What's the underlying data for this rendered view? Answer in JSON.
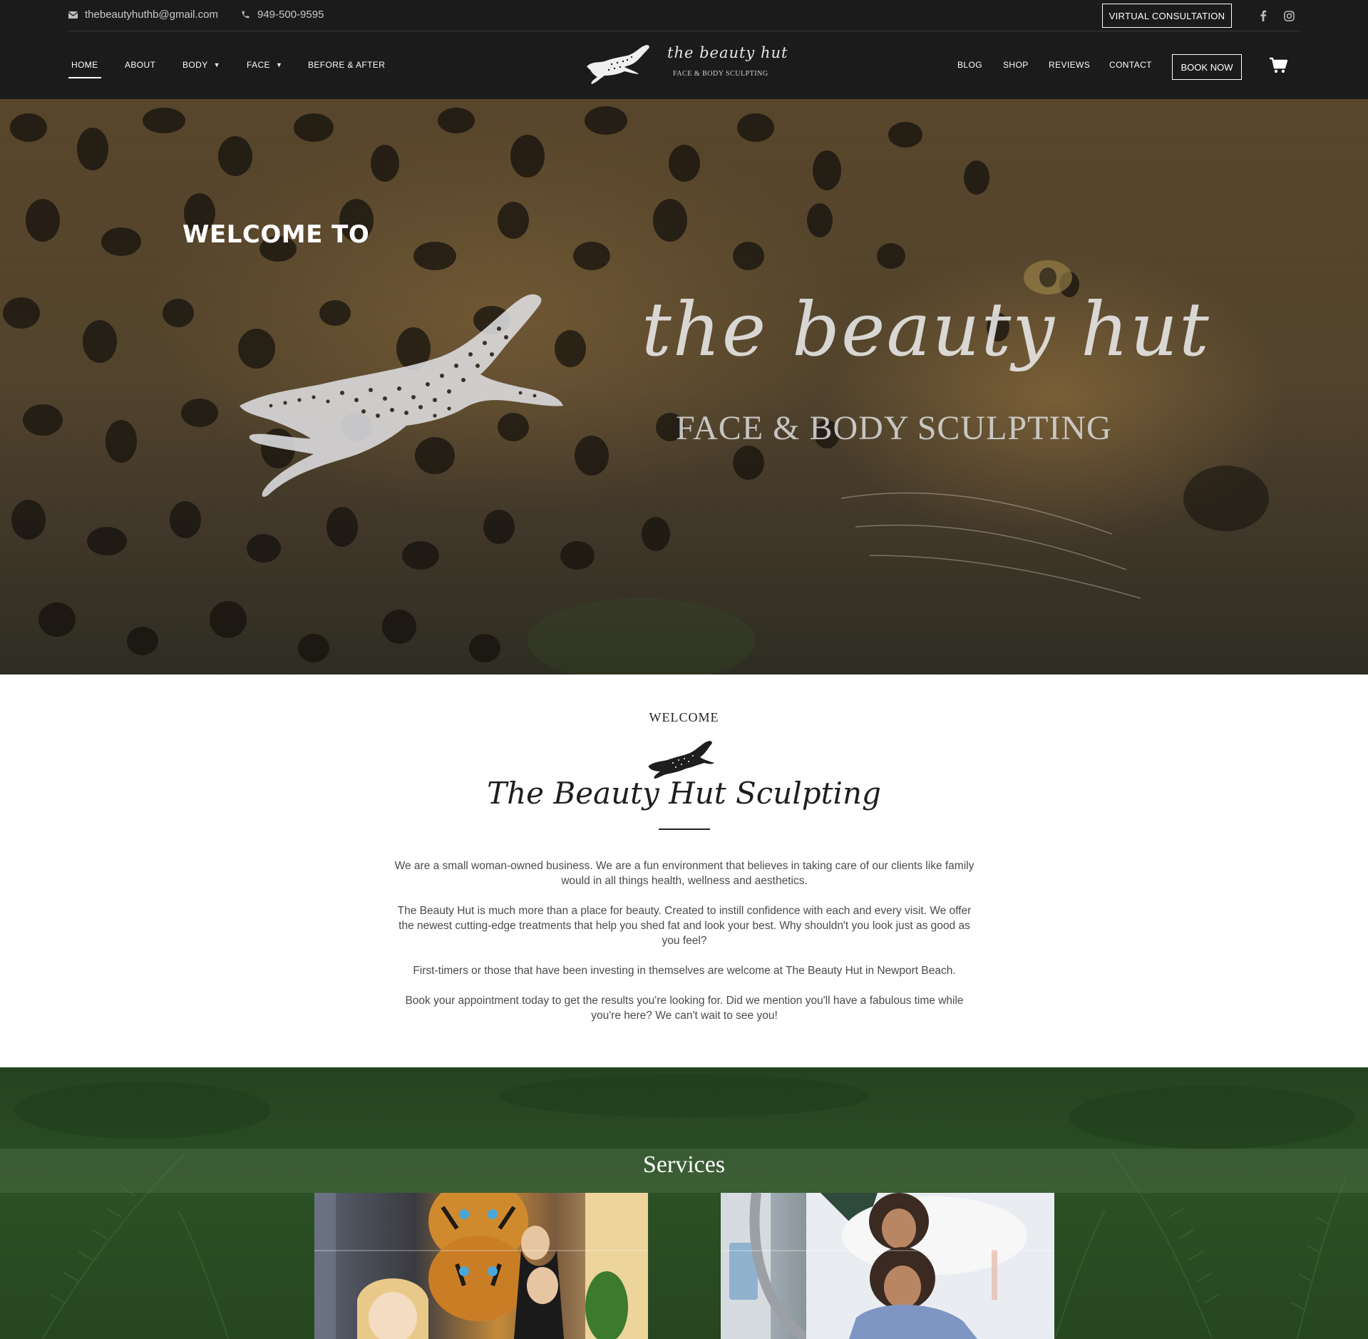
{
  "topbar": {
    "email": "thebeautyhuthb@gmail.com",
    "phone": "949-500-9595",
    "virtual_consultation": "VIRTUAL CONSULTATION",
    "social": [
      "facebook-icon",
      "instagram-icon"
    ]
  },
  "nav": {
    "left": [
      {
        "label": "HOME",
        "active": true
      },
      {
        "label": "ABOUT"
      },
      {
        "label": "BODY",
        "dropdown": true
      },
      {
        "label": "FACE",
        "dropdown": true
      },
      {
        "label": "BEFORE & AFTER"
      }
    ],
    "right": [
      {
        "label": "BLOG"
      },
      {
        "label": "SHOP"
      },
      {
        "label": "REVIEWS"
      },
      {
        "label": "CONTACT"
      }
    ],
    "book_now": "BOOK NOW",
    "logo_script": "the beauty hut",
    "logo_sub": "FACE & BODY SCULPTING"
  },
  "hero": {
    "welcome": "WELCOME TO",
    "brand": "the beauty hut",
    "tagline": "FACE & BODY SCULPTING"
  },
  "welcome": {
    "eyebrow": "WELCOME",
    "title": "The Beauty Hut Sculpting",
    "paragraphs": [
      "We are a small woman-owned business. We are a fun environment that believes in taking care of our clients like family would in all things health, wellness and aesthetics.",
      "The Beauty Hut is much more than a place for beauty. Created to instill confidence with each and every visit. We offer the newest cutting-edge treatments that help you shed fat and look your best. Why shouldn't you look just as good as you feel?",
      "First-timers or those that have been investing in themselves are welcome at The Beauty Hut in Newport Beach.",
      "Book your appointment today to get the results you're looking for. Did we mention you'll have a fabulous time while you're here? We can't wait to see you!"
    ]
  },
  "services": {
    "title": "Services"
  },
  "colors": {
    "header_bg": "#1b1b1b",
    "services_green": "#2c5026",
    "text": "#4a4a4a"
  }
}
